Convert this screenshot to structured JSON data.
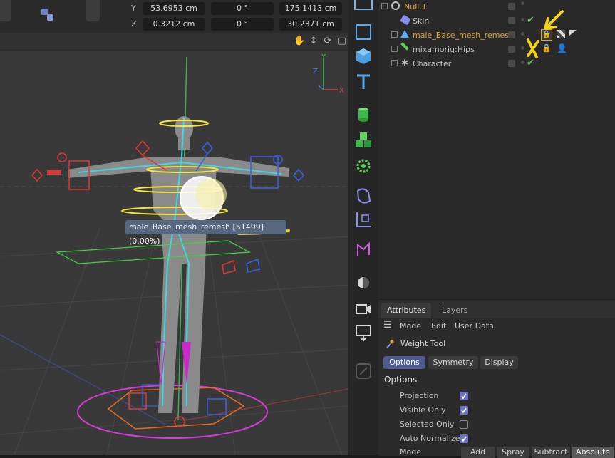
{
  "coords": {
    "y_axis": "Y",
    "z_axis": "Z",
    "y_position": "53.6953 cm",
    "y_rotation": "0 °",
    "y_size": "175.1413 cm",
    "z_position": "0.3212 cm",
    "z_rotation": "0 °",
    "z_size": "30.2371 cm"
  },
  "viewport": {
    "tooltip": "male_Base_mesh_remesh [51499] (0.00%)",
    "axis_y": "Y",
    "axis_z": "Z",
    "axis_x": "X",
    "toolbar_icons": [
      "hand-icon",
      "move-icon",
      "rotate-icon",
      "window-icon"
    ]
  },
  "objects": {
    "rows": [
      {
        "name": "Null.1",
        "icon": "null-icon"
      },
      {
        "name": "Skin",
        "icon": "skin-icon"
      },
      {
        "name": "male_Base_mesh_remesh",
        "icon": "mesh-icon"
      },
      {
        "name": "mixamorig:Hips",
        "icon": "joint-icon"
      },
      {
        "name": "Character",
        "icon": "character-icon"
      }
    ]
  },
  "attributes": {
    "tabs": [
      "Attributes",
      "Layers"
    ],
    "menu": [
      "Mode",
      "Edit",
      "User Data"
    ],
    "tool_title": "Weight Tool",
    "sub_tabs": [
      "Options",
      "Symmetry",
      "Display"
    ],
    "section": "Options",
    "options": [
      {
        "label": "Projection",
        "checked": true
      },
      {
        "label": "Visible Only",
        "checked": true
      },
      {
        "label": "Selected Only",
        "checked": false
      },
      {
        "label": "Auto Normalize",
        "checked": true
      }
    ],
    "mode_label": "Mode",
    "mode_buttons": [
      "Add",
      "Spray",
      "Subtract",
      "Absolute"
    ]
  },
  "colors": {
    "accent": "#4f5b8f",
    "selected_text": "#e3a43a",
    "annotation": "#f5d418",
    "check": "#59c85b"
  }
}
